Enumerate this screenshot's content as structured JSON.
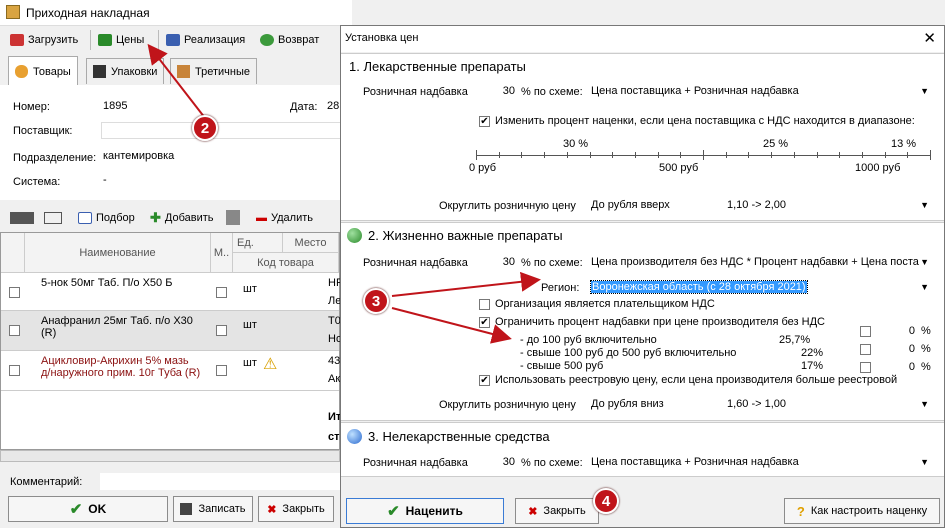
{
  "main_window": {
    "title": "Приходная накладная",
    "toolbar": [
      "Загрузить",
      "Цены",
      "Реализация",
      "Возврат"
    ],
    "tabs": [
      "Товары",
      "Упаковки",
      "Третичные"
    ],
    "fields": {
      "number_label": "Номер:",
      "number_value": "1895",
      "date_label": "Дата:",
      "date_value": "28.",
      "supplier_label": "Поставщик:",
      "division_label": "Подразделение:",
      "division_value": "кантемировка",
      "system_label": "Система:",
      "system_value": "-"
    },
    "grid_toolbar": {
      "select": "Подбор",
      "add": "Добавить",
      "delete": "Удалить"
    },
    "grid_headers": {
      "name": "Наименование",
      "m": "М..",
      "unit": "Ед.",
      "place": "Место",
      "code": "Код товара"
    },
    "rows": [
      {
        "name": "5-нок 50мг Таб. П/о X50 Б",
        "unit": "шт",
        "extra1": "НР",
        "extra2": "Ле"
      },
      {
        "name": "Анафранил 25мг Таб. п/о X30\n(R)",
        "unit": "шт",
        "extra1": "Т0",
        "extra2": "Но"
      },
      {
        "name": "Ацикловир-Акрихин 5% мазь\nд/наружного прим. 10г Туба (R)",
        "unit": "шт",
        "extra1": "43",
        "extra2": "Ак"
      }
    ],
    "totals": [
      "Ит",
      "ст"
    ],
    "comment_label": "Комментарий:",
    "buttons": {
      "ok": "OK",
      "save": "Записать",
      "close": "Закрыть"
    }
  },
  "dialog": {
    "title": "Установка цен",
    "section1": {
      "title": "1. Лекарственные препараты",
      "markup_label": "Розничная надбавка",
      "markup_value": "30",
      "scheme_label": "% по схеме:",
      "scheme_value": "Цена поставщика + Розничная надбавка",
      "range_check": "Изменить процент наценки, если цена поставщика с НДС находится в диапазоне:",
      "scale_pcts": [
        "30 %",
        "25 %",
        "13 %"
      ],
      "scale_labels": [
        "0 руб",
        "500 руб",
        "1000 руб"
      ],
      "round_label": "Округлить розничную цену",
      "round_value": "До рубля вверх",
      "round_example": "1,10 -> 2,00"
    },
    "section2": {
      "title": "2. Жизненно важные препараты",
      "markup_label": "Розничная надбавка",
      "markup_value": "30",
      "scheme_label": "% по схеме:",
      "scheme_value": "Цена производителя без НДС * Процент надбавки + Цена поста",
      "region_label": "Регион:",
      "region_value": "Воронежская область (с 28 октября 2021)",
      "vat_payer": "Организация является плательщиком НДС",
      "limit_check": "Ограничить процент надбавки при цене производителя без НДС",
      "limits": [
        {
          "label": "- до 100 руб  включительно",
          "pct": "25,7%",
          "override": "0"
        },
        {
          "label": "- свыше 100 руб до 500 руб включительно",
          "pct": "22%",
          "override": "0"
        },
        {
          "label": "- свыше 500 руб",
          "pct": "17%",
          "override": "0"
        }
      ],
      "pct_sign": "%",
      "registry_check": "Использовать реестровую цену, если цена производителя больше реестровой",
      "round_label": "Округлить розничную цену",
      "round_value": "До рубля вниз",
      "round_example": "1,60 -> 1,00"
    },
    "section3": {
      "title": "3. Нелекарственные средства",
      "markup_label": "Розничная надбавка",
      "markup_value": "30",
      "scheme_label": "% по схеме:",
      "scheme_value": "Цена поставщика + Розничная надбавка"
    },
    "buttons": {
      "apply": "Наценить",
      "close": "Закрыть",
      "help": "Как настроить наценку"
    }
  },
  "markers": [
    "2",
    "3",
    "4"
  ],
  "colors": {
    "arrow": "#c0141a",
    "highlight": "#3399ff"
  }
}
